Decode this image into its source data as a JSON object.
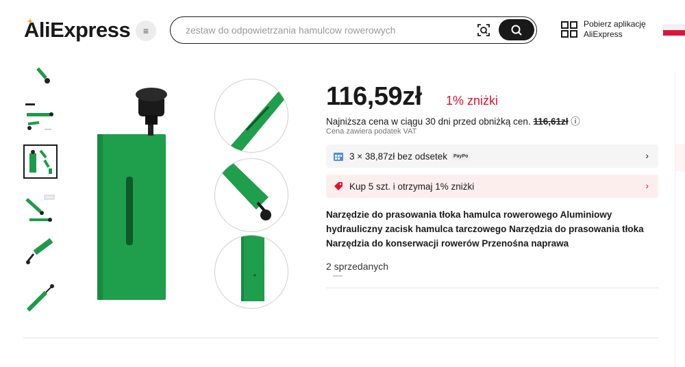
{
  "header": {
    "logo": "AliExpress",
    "search": {
      "placeholder": "zestaw do odpowietrzania hamulcow rowerowych"
    },
    "app_line1": "Pobierz aplikację",
    "app_line2": "AliExpress"
  },
  "product": {
    "price": "116,59zł",
    "discount": "1% zniżki",
    "lowest_price_text": "Najniższa cena w ciągu 30 dni przed obniżką cen.",
    "lowest_price_value": "116,61zł",
    "vat": "Cena zawiera podatek VAT",
    "installments": "3 × 38,87zł bez odsetek",
    "paypo": "PayPo",
    "bulk_offer": "Kup 5 szt. i otrzymaj 1% zniżki",
    "title": "Narzędzie do prasowania tłoka hamulca rowerowego Aluminiowy hydrauliczny zacisk hamulca tarczowego Narzędzia do prasowania tłoka Narzędzia do konserwacji rowerów Przenośna naprawa",
    "sold": "2 sprzedanych"
  },
  "colors": {
    "accent_red": "#e0112b",
    "product_green": "#1e9b4a"
  }
}
